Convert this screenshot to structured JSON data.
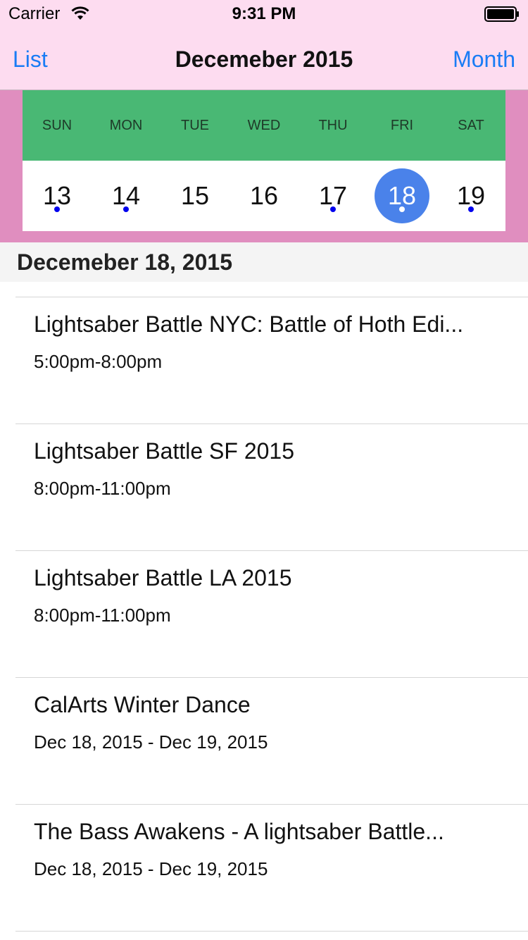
{
  "status_bar": {
    "carrier": "Carrier",
    "time": "9:31 PM"
  },
  "nav": {
    "left": "List",
    "title": "Decemeber 2015",
    "right": "Month"
  },
  "week": {
    "days": [
      "SUN",
      "MON",
      "TUE",
      "WED",
      "THU",
      "FRI",
      "SAT"
    ],
    "dates": [
      {
        "num": "13",
        "has_event": true
      },
      {
        "num": "14",
        "has_event": true
      },
      {
        "num": "15",
        "has_event": false
      },
      {
        "num": "16",
        "has_event": false
      },
      {
        "num": "17",
        "has_event": true
      },
      {
        "num": "18",
        "has_event": true,
        "selected": true
      },
      {
        "num": "19",
        "has_event": true
      }
    ]
  },
  "section": {
    "title": "Decemeber 18, 2015"
  },
  "events": [
    {
      "title": "Lightsaber Battle NYC: Battle of Hoth Edi...",
      "time": "5:00pm-8:00pm"
    },
    {
      "title": "Lightsaber Battle SF 2015",
      "time": "8:00pm-11:00pm"
    },
    {
      "title": "Lightsaber Battle LA 2015",
      "time": "8:00pm-11:00pm"
    },
    {
      "title": "CalArts Winter Dance",
      "time": "Dec 18, 2015 - Dec 19, 2015"
    },
    {
      "title": "The Bass Awakens - A lightsaber Battle...",
      "time": "Dec 18, 2015 - Dec 19, 2015"
    }
  ],
  "colors": {
    "nav_background": "#fddcf0",
    "week_frame": "#e08ebf",
    "weekday_header": "#49b874",
    "selected_day": "#4a82ea",
    "event_dot": "#0000ee",
    "link": "#1a7cf5"
  }
}
